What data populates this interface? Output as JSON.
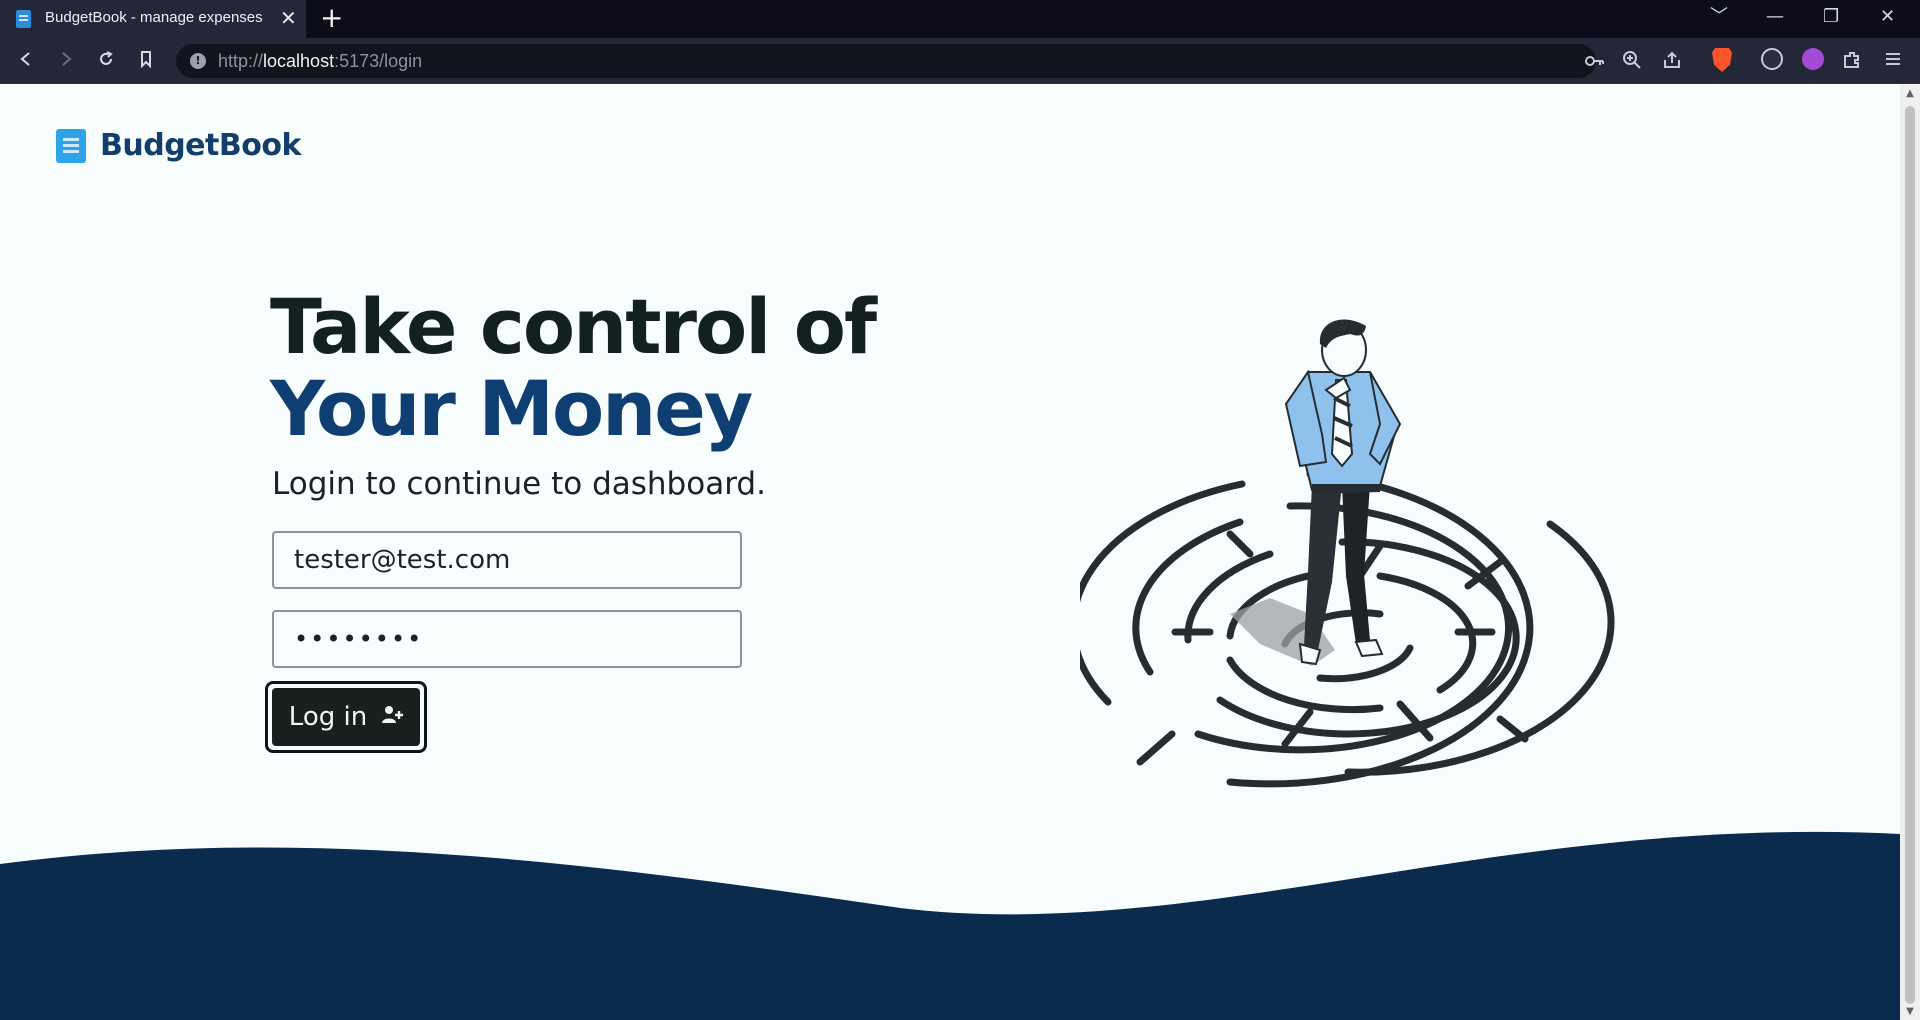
{
  "browser": {
    "tab_title": "BudgetBook - manage expenses",
    "tab_close": "✕",
    "new_tab": "+",
    "url_host_prefix": "http://",
    "url_host": "localhost",
    "url_rest": ":5173/login",
    "window_controls": [
      "﹀",
      "—",
      "❐",
      "✕"
    ]
  },
  "brand": {
    "name": "BudgetBook",
    "icon": "receipt-icon",
    "color": "#123e6c"
  },
  "hero": {
    "line1": "Take control of",
    "line2": "Your Money",
    "subtitle": "Login to continue to dashboard."
  },
  "form": {
    "email_value": "tester@test.com",
    "password_value": "••••••••",
    "login_label": "Log in",
    "login_icon": "user-plus-icon"
  },
  "colors": {
    "accent": "#0f3f72",
    "dark": "#16211f",
    "wave": "#0a2a4e",
    "shirt": "#8ec2ec"
  }
}
